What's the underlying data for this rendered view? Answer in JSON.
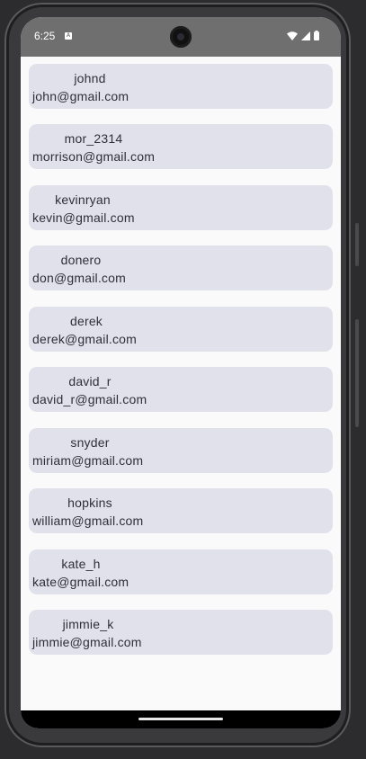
{
  "status_bar": {
    "time": "6:25",
    "notification_icon": "a-icon",
    "wifi_icon": "wifi-icon",
    "signal_icon": "signal-icon",
    "battery_icon": "battery-icon"
  },
  "users": [
    {
      "username": "johnd",
      "email": "john@gmail.com"
    },
    {
      "username": "mor_2314",
      "email": "morrison@gmail.com"
    },
    {
      "username": "kevinryan",
      "email": "kevin@gmail.com"
    },
    {
      "username": "donero",
      "email": "don@gmail.com"
    },
    {
      "username": "derek",
      "email": "derek@gmail.com"
    },
    {
      "username": "david_r",
      "email": "david_r@gmail.com"
    },
    {
      "username": "snyder",
      "email": "miriam@gmail.com"
    },
    {
      "username": "hopkins",
      "email": "william@gmail.com"
    },
    {
      "username": "kate_h",
      "email": "kate@gmail.com"
    },
    {
      "username": "jimmie_k",
      "email": "jimmie@gmail.com"
    }
  ]
}
